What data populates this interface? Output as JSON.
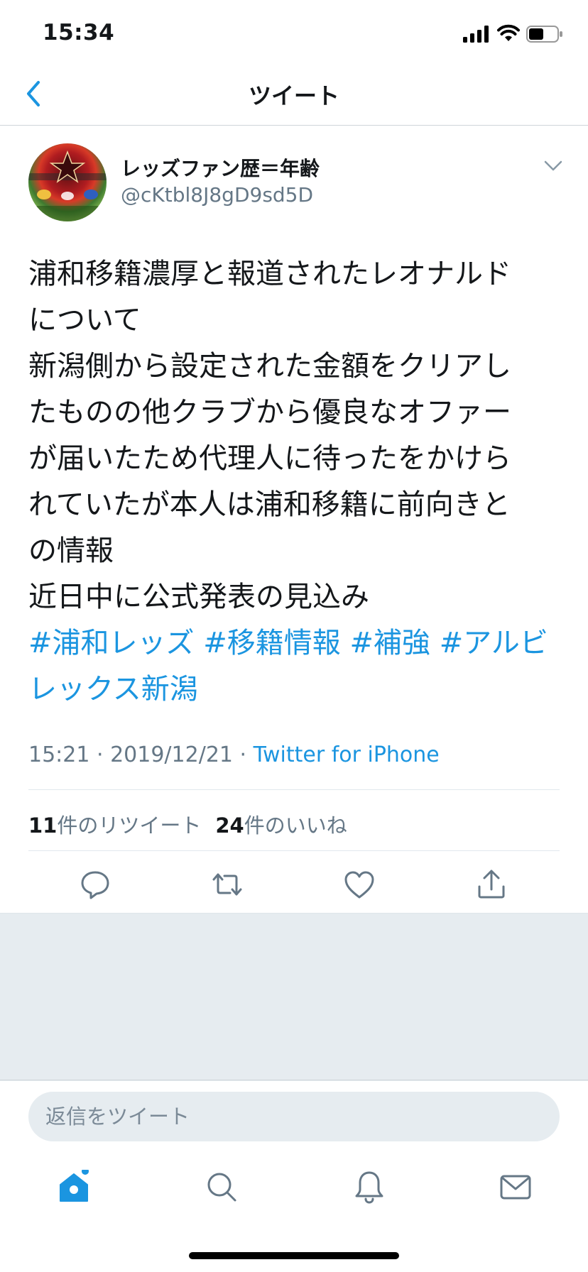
{
  "status_bar": {
    "time": "15:34"
  },
  "nav": {
    "title": "ツイート",
    "back_icon": "chevron-left-icon"
  },
  "author": {
    "name": "レッズファン歴＝年齢",
    "handle": "@cKtbl8J8gD9sd5D"
  },
  "tweet": {
    "lines": [
      "浦和移籍濃厚と報道されたレオナルド",
      "について",
      "新潟側から設定された金額をクリアし",
      "たものの他クラブから優良なオファー",
      "が届いたため代理人に待ったをかけら",
      "れていたが本人は浦和移籍に前向きと",
      "の情報",
      "近日中に公式発表の見込み"
    ],
    "hashtags": [
      "#浦和レッズ",
      "#移籍情報",
      "#補強",
      "#アルビ",
      "レックス新潟"
    ]
  },
  "meta": {
    "time": "15:21",
    "sep": " · ",
    "date": "2019/12/21",
    "source": "Twitter for iPhone"
  },
  "stats": {
    "retweets": "11",
    "retweets_label": "件のリツイート",
    "likes": "24",
    "likes_label": "件のいいね"
  },
  "actions": [
    "reply-icon",
    "retweet-icon",
    "like-icon",
    "share-icon"
  ],
  "reply": {
    "placeholder": "返信をツイート"
  },
  "tab_bar": [
    "home-icon",
    "search-icon",
    "notifications-icon",
    "messages-icon"
  ],
  "colors": {
    "accent": "#1b95e0",
    "secondary_text": "#657786",
    "divider": "#e1e8ed",
    "background_grey": "#e6ecf0"
  }
}
